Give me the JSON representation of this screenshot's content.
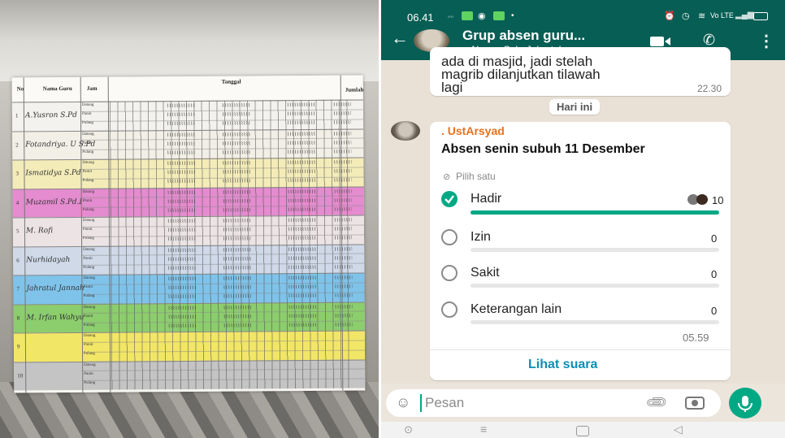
{
  "photo": {
    "sheet_title": "Tanggal",
    "col_no": "No",
    "col_nama": "Nama Guru",
    "col_jam": "Jam",
    "col_jumlah": "Jumlah",
    "sub_labels": [
      "Datang",
      "Pamit",
      "Pulang"
    ],
    "teachers": [
      {
        "no": "1",
        "name": "A.Yusron S.Pd",
        "color": "#f3f2ee"
      },
      {
        "no": "2",
        "name": "Fotandriya. U S.Pd",
        "color": "#f2efe6"
      },
      {
        "no": "3",
        "name": "Ismatidya S.Pd",
        "color": "#f4ecb8"
      },
      {
        "no": "4",
        "name": "Muzamil S.Pd.I",
        "color": "#e48ccf"
      },
      {
        "no": "5",
        "name": "M. Rofi",
        "color": "#ece4e4"
      },
      {
        "no": "6",
        "name": "Nurhidayah",
        "color": "#cfd9e8"
      },
      {
        "no": "7",
        "name": "Jahratul Jannah",
        "color": "#7fc3ea"
      },
      {
        "no": "8",
        "name": "M. Irfan Wahyu",
        "color": "#8ccd6d"
      },
      {
        "no": "9",
        "name": "",
        "color": "#f2e667"
      },
      {
        "no": "10",
        "name": "",
        "color": "#c4c4c4"
      }
    ]
  },
  "status": {
    "time": "06.41",
    "signal": "Vo LTE"
  },
  "header": {
    "title": "Grup absen guru...",
    "subtitle": "., Abuya, Gyh, Jahratul, ..."
  },
  "prev_message": {
    "line1": "ada di masjid, jadi stelah",
    "line2": "magrib dilanjutkan tilawah",
    "line3": "lagi",
    "time": "22.30"
  },
  "date_chip": "Hari ini",
  "poll": {
    "sender": ". UstArsyad",
    "question": "Absen senin subuh 11 Desember",
    "hint": "Pilih satu",
    "options": [
      {
        "label": "Hadir",
        "votes": "10",
        "fraction": 1.0,
        "checked": true
      },
      {
        "label": "Izin",
        "votes": "0",
        "fraction": 0.0,
        "checked": false
      },
      {
        "label": "Sakit",
        "votes": "0",
        "fraction": 0.0,
        "checked": false
      },
      {
        "label": "Keterangan lain",
        "votes": "0",
        "fraction": 0.0,
        "checked": false
      }
    ],
    "time": "05.59",
    "view_votes": "Lihat suara"
  },
  "input": {
    "placeholder": "Pesan"
  },
  "colors": {
    "header": "#075e54",
    "accent": "#00a884",
    "poll_bar": "#00a884",
    "link": "#0b8fb5",
    "sender": "#e9711c"
  }
}
